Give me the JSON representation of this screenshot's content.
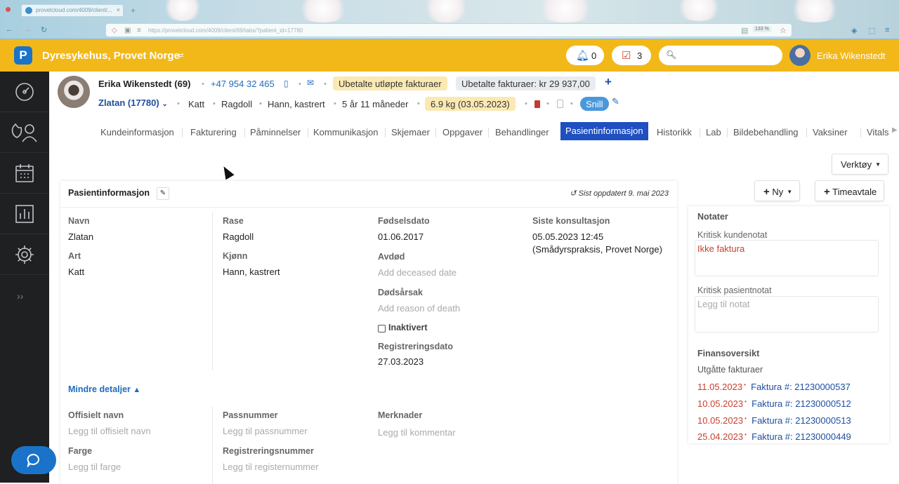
{
  "browser": {
    "tab_title": "provetcloud.com/4009/client/...",
    "url": "https://provetcloud.com/4009/client/69/tabs/?patient_id=17780",
    "zoom": "133 %"
  },
  "header": {
    "clinic_name": "Dyresykehus, Provet Norge",
    "logo_letter": "P",
    "notifications_count": "0",
    "tasks_count": "3",
    "search_placeholder": "",
    "user_name": "Erika Wikenstedt"
  },
  "sidebar": {
    "items": [
      "dashboard-icon",
      "clients-icon",
      "calendar-icon",
      "reports-icon",
      "settings-icon"
    ],
    "expand_label": "››"
  },
  "client": {
    "name": "Erika Wikenstedt",
    "id": "(69)",
    "phone": "+47 954 32 465",
    "badge_overdue": "Ubetalte utløpte fakturaer",
    "badge_unpaid": "Ubetalte fakturaer: kr 29 937,00"
  },
  "patient": {
    "name": "Zlatan (17780)",
    "species": "Katt",
    "breed": "Ragdoll",
    "sex": "Hann, kastrert",
    "age": "5 år 11 måneder",
    "weight": "6.9 kg (03.05.2023)",
    "tag": "Snill"
  },
  "tabs": [
    {
      "label": "Kundeinformasjon"
    },
    {
      "label": "Fakturering"
    },
    {
      "label": "Påminnelser"
    },
    {
      "label": "Kommunikasjon"
    },
    {
      "label": "Skjemaer"
    },
    {
      "label": "Oppgaver"
    },
    {
      "label": "Behandlinger"
    },
    {
      "label": "Pasientinformasjon"
    },
    {
      "label": "Historikk"
    },
    {
      "label": "Lab"
    },
    {
      "label": "Bildebehandling"
    },
    {
      "label": "Vaksiner"
    },
    {
      "label": "Vitals"
    }
  ],
  "toolbar": {
    "tools_label": "Verktøy",
    "new_label": "Ny",
    "appointment_label": "Timeavtale"
  },
  "card": {
    "title": "Pasientinformasjon",
    "updated": "Sist oppdatert 9. mai 2023",
    "name_label": "Navn",
    "name_value": "Zlatan",
    "species_label": "Art",
    "species_value": "Katt",
    "breed_label": "Rase",
    "breed_value": "Ragdoll",
    "sex_label": "Kjønn",
    "sex_value": "Hann, kastrert",
    "birth_label": "Fødselsdato",
    "birth_value": "01.06.2017",
    "deceased_label": "Avdød",
    "deceased_placeholder": "Add deceased date",
    "death_cause_label": "Dødsårsak",
    "death_cause_placeholder": "Add reason of death",
    "inactive_label": "Inaktivert",
    "registration_date_label": "Registreringsdato",
    "registration_date_value": "27.03.2023",
    "last_consult_label": "Siste konsultasjon",
    "last_consult_value": "05.05.2023 12:45",
    "last_consult_place": "(Smådyrspraksis, Provet Norge)",
    "less_details": "Mindre detaljer",
    "official_name_label": "Offisielt navn",
    "official_name_placeholder": "Legg til offisielt navn",
    "passport_label": "Passnummer",
    "passport_placeholder": "Legg til passnummer",
    "remarks_label": "Merknader",
    "remarks_placeholder": "Legg til kommentar",
    "color_label": "Farge",
    "color_placeholder": "Legg til farge",
    "reg_number_label": "Registreringsnummer",
    "reg_number_placeholder": "Legg til registernummer"
  },
  "notes": {
    "title": "Notater",
    "client_note_label": "Kritisk kundenotat",
    "client_note_value": "Ikke faktura",
    "patient_note_label": "Kritisk pasientnotat",
    "patient_note_placeholder": "Legg til notat"
  },
  "finance": {
    "title": "Finansoversikt",
    "overdue_label": "Utgåtte fakturaer",
    "rows": [
      {
        "date": "11.05.2023",
        "invoice": "Faktura #: 21230000537"
      },
      {
        "date": "10.05.2023",
        "invoice": "Faktura #: 21230000512"
      },
      {
        "date": "10.05.2023",
        "invoice": "Faktura #: 21230000513"
      },
      {
        "date": "25.04.2023",
        "invoice": "Faktura #: 21230000449"
      }
    ]
  },
  "colors": {
    "header": "#f2b81a",
    "brand_blue": "#1f4fc0",
    "sidebar": "#1f2021",
    "overdue_red": "#c8412d"
  }
}
